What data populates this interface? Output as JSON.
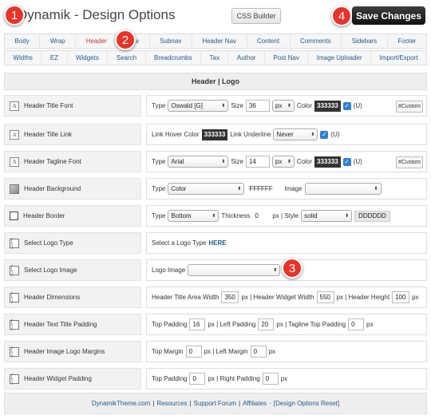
{
  "header": {
    "title": "Dynamik - Design Options",
    "css_builder": "CSS Builder",
    "save": "Save Changes"
  },
  "callouts": [
    "1",
    "2",
    "3",
    "4"
  ],
  "tabs_row1": [
    "Body",
    "Wrap",
    "Header",
    "Nav",
    "Subnav",
    "Header Nav",
    "Content",
    "Comments",
    "Sidebars",
    "Footer"
  ],
  "tabs_row2": [
    "Widths",
    "EZ",
    "Widgets",
    "Search",
    "Breadcrumbs",
    "Tax",
    "Author",
    "Post Nav",
    "Image Uploader",
    "Import/Export"
  ],
  "active_tab": "Header",
  "section_title": "Header | Logo",
  "rows": {
    "title_font": {
      "label": "Header Title Font",
      "type_label": "Type",
      "type_value": "Oswald [G]",
      "size_label": "Size",
      "size_value": "36",
      "unit": "px",
      "color_label": "Color",
      "color_value": "333333",
      "u_label": "(U)",
      "custom": "#Custom"
    },
    "title_link": {
      "label": "Header Title Link",
      "hover_label": "Link Hover Color",
      "hover_value": "333333",
      "underline_label": "Link Underline",
      "underline_value": "Never",
      "u_label": "(U)"
    },
    "tagline_font": {
      "label": "Header Tagline Font",
      "type_label": "Type",
      "type_value": "Arial",
      "size_label": "Size",
      "size_value": "14",
      "unit": "px",
      "color_label": "Color",
      "color_value": "333333",
      "u_label": "(U)",
      "custom": "#Custom"
    },
    "background": {
      "label": "Header Background",
      "type_label": "Type",
      "type_value": "Color",
      "color_value": "FFFFFF",
      "image_label": "Image",
      "image_value": ""
    },
    "border": {
      "label": "Header Border",
      "type_label": "Type",
      "type_value": "Bottom",
      "thickness_label": "Thickness",
      "thickness_value": "0",
      "style_label": "px | Style",
      "style_value": "solid",
      "color_value": "DDDDDD"
    },
    "logo_type": {
      "label": "Select Logo Type",
      "text": "Select a Logo Type",
      "link": "HERE"
    },
    "logo_image": {
      "label": "Select Logo Image",
      "image_label": "Logo Image",
      "image_value": ""
    },
    "dimensions": {
      "label": "Header Dimensions",
      "a_label": "Header Title Area Width",
      "a_value": "350",
      "b_label": "px | Header Widget Width",
      "b_value": "550",
      "c_label": "px | Header Height",
      "c_value": "100",
      "d_label": "px"
    },
    "text_padding": {
      "label": "Header Text Title Padding",
      "a_label": "Top Padding",
      "a_value": "16",
      "b_label": "px | Left Padding",
      "b_value": "20",
      "c_label": "px | Tagline Top Padding",
      "c_value": "0",
      "d_label": "px"
    },
    "image_margins": {
      "label": "Header Image Logo Margins",
      "a_label": "Top Margin",
      "a_value": "0",
      "b_label": "px | Left Margin",
      "b_value": "0",
      "c_label": "px"
    },
    "widget_padding": {
      "label": "Header Widget Padding",
      "a_label": "Top Padding",
      "a_value": "0",
      "b_label": "px | Right Padding",
      "b_value": "0",
      "c_label": "px"
    }
  },
  "footer": {
    "site": "DynamikTheme.com",
    "sep": "|",
    "resources": "Resources",
    "support": "Support Forum",
    "affiliates": "Affiliates",
    "dot": "·",
    "reset": "[Design Options Reset]"
  },
  "colors": {
    "accent": "#1f5a8c",
    "callout": "#e8332a",
    "save_bg": "#222222"
  }
}
